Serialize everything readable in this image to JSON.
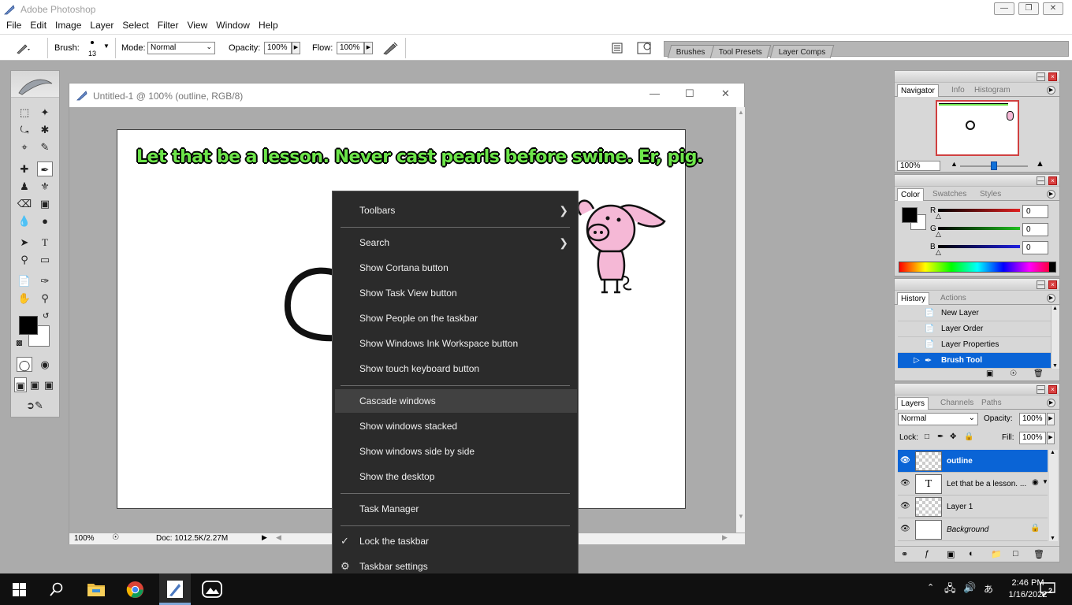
{
  "app": {
    "title": "Adobe Photoshop"
  },
  "menu": [
    "File",
    "Edit",
    "Image",
    "Layer",
    "Select",
    "Filter",
    "View",
    "Window",
    "Help"
  ],
  "options": {
    "brush_label": "Brush:",
    "brush_size": "13",
    "mode_label": "Mode:",
    "mode_value": "Normal",
    "opacity_label": "Opacity:",
    "opacity_value": "100%",
    "flow_label": "Flow:",
    "flow_value": "100%"
  },
  "well_tabs": [
    "Brushes",
    "Tool Presets",
    "Layer Comps"
  ],
  "document": {
    "title": "Untitled-1 @ 100% (outline, RGB/8)",
    "caption": "Let that be a lesson. Never cast pearls before swine. Er, pig.",
    "zoom": "100%",
    "doc_info": "Doc: 1012.5K/2.27M"
  },
  "context_menu": {
    "items": [
      {
        "label": "Toolbars",
        "submenu": true
      },
      {
        "label": "Search",
        "submenu": true
      },
      {
        "label": "Show Cortana button"
      },
      {
        "label": "Show Task View button"
      },
      {
        "label": "Show People on the taskbar"
      },
      {
        "label": "Show Windows Ink Workspace button"
      },
      {
        "label": "Show touch keyboard button"
      },
      {
        "label": "Cascade windows"
      },
      {
        "label": "Show windows stacked"
      },
      {
        "label": "Show windows side by side"
      },
      {
        "label": "Show the desktop"
      },
      {
        "label": "Task Manager"
      },
      {
        "label": "Lock the taskbar",
        "checked": true
      },
      {
        "label": "Taskbar settings"
      }
    ]
  },
  "navigator": {
    "tabs": [
      "Navigator",
      "Info",
      "Histogram"
    ],
    "zoom": "100%"
  },
  "color_panel": {
    "tabs": [
      "Color",
      "Swatches",
      "Styles"
    ],
    "channels": [
      {
        "name": "R",
        "value": "0",
        "color": "#e02020"
      },
      {
        "name": "G",
        "value": "0",
        "color": "#20c020"
      },
      {
        "name": "B",
        "value": "0",
        "color": "#2020e0"
      }
    ]
  },
  "history": {
    "tabs": [
      "History",
      "Actions"
    ],
    "items": [
      "New Layer",
      "Layer Order",
      "Layer Properties",
      "Brush Tool"
    ],
    "selected": 3
  },
  "layers": {
    "tabs": [
      "Layers",
      "Channels",
      "Paths"
    ],
    "blend_mode": "Normal",
    "opacity_label": "Opacity:",
    "opacity_value": "100%",
    "lock_label": "Lock:",
    "fill_label": "Fill:",
    "fill_value": "100%",
    "items": [
      "outline",
      "Let that be a lesson. ...",
      "Layer 1",
      "Background"
    ],
    "selected": 0
  },
  "taskbar": {
    "time": "2:46 PM",
    "date": "1/16/2022",
    "notification_count": "2"
  },
  "colors": {
    "accent": "#0a64d6",
    "menu_bg": "#2b2b2b",
    "caption_text": "#6de54a"
  }
}
